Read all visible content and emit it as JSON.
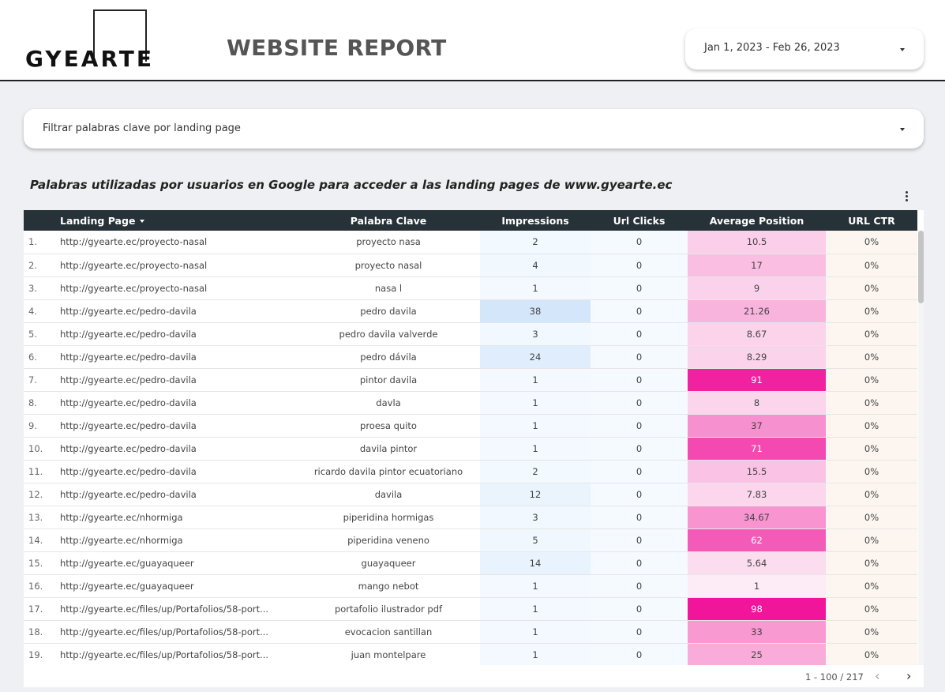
{
  "header": {
    "logo_text": "GYEARTE",
    "title": "WEBSITE REPORT",
    "date_range": "Jan 1, 2023 - Feb 26, 2023"
  },
  "filter": {
    "label": "Filtrar palabras clave por landing page"
  },
  "report": {
    "subtitle": "Palabras utilizadas por usuarios en Google para acceder a las landing pages de www.gyearte.ec"
  },
  "table": {
    "columns": [
      "Landing Page",
      "Palabra Clave",
      "Impressions",
      "Url Clicks",
      "Average Position",
      "URL CTR"
    ],
    "sorted_column": "Landing Page",
    "rows": [
      {
        "idx": "1.",
        "landing": "http://gyearte.ec/proyecto-nasal",
        "keyword": "proyecto nasa",
        "impressions": 2,
        "clicks": 0,
        "position": 10.5,
        "ctr": "0%"
      },
      {
        "idx": "2.",
        "landing": "http://gyearte.ec/proyecto-nasal",
        "keyword": "proyecto nasal",
        "impressions": 4,
        "clicks": 0,
        "position": 17,
        "ctr": "0%"
      },
      {
        "idx": "3.",
        "landing": "http://gyearte.ec/proyecto-nasal",
        "keyword": "nasa l",
        "impressions": 1,
        "clicks": 0,
        "position": 9,
        "ctr": "0%"
      },
      {
        "idx": "4.",
        "landing": "http://gyearte.ec/pedro-davila",
        "keyword": "pedro davila",
        "impressions": 38,
        "clicks": 0,
        "position": 21.26,
        "ctr": "0%"
      },
      {
        "idx": "5.",
        "landing": "http://gyearte.ec/pedro-davila",
        "keyword": "pedro davila valverde",
        "impressions": 3,
        "clicks": 0,
        "position": 8.67,
        "ctr": "0%"
      },
      {
        "idx": "6.",
        "landing": "http://gyearte.ec/pedro-davila",
        "keyword": "pedro dávila",
        "impressions": 24,
        "clicks": 0,
        "position": 8.29,
        "ctr": "0%"
      },
      {
        "idx": "7.",
        "landing": "http://gyearte.ec/pedro-davila",
        "keyword": "pintor davila",
        "impressions": 1,
        "clicks": 0,
        "position": 91,
        "ctr": "0%"
      },
      {
        "idx": "8.",
        "landing": "http://gyearte.ec/pedro-davila",
        "keyword": "davla",
        "impressions": 1,
        "clicks": 0,
        "position": 8,
        "ctr": "0%"
      },
      {
        "idx": "9.",
        "landing": "http://gyearte.ec/pedro-davila",
        "keyword": "proesa quito",
        "impressions": 1,
        "clicks": 0,
        "position": 37,
        "ctr": "0%"
      },
      {
        "idx": "10.",
        "landing": "http://gyearte.ec/pedro-davila",
        "keyword": "davila pintor",
        "impressions": 1,
        "clicks": 0,
        "position": 71,
        "ctr": "0%"
      },
      {
        "idx": "11.",
        "landing": "http://gyearte.ec/pedro-davila",
        "keyword": "ricardo davila pintor ecuatoriano",
        "impressions": 2,
        "clicks": 0,
        "position": 15.5,
        "ctr": "0%"
      },
      {
        "idx": "12.",
        "landing": "http://gyearte.ec/pedro-davila",
        "keyword": "davila",
        "impressions": 12,
        "clicks": 0,
        "position": 7.83,
        "ctr": "0%"
      },
      {
        "idx": "13.",
        "landing": "http://gyearte.ec/nhormiga",
        "keyword": "piperidina hormigas",
        "impressions": 3,
        "clicks": 0,
        "position": 34.67,
        "ctr": "0%"
      },
      {
        "idx": "14.",
        "landing": "http://gyearte.ec/nhormiga",
        "keyword": "piperidina veneno",
        "impressions": 5,
        "clicks": 0,
        "position": 62,
        "ctr": "0%"
      },
      {
        "idx": "15.",
        "landing": "http://gyearte.ec/guayaqueer",
        "keyword": "guayaqueer",
        "impressions": 14,
        "clicks": 0,
        "position": 5.64,
        "ctr": "0%"
      },
      {
        "idx": "16.",
        "landing": "http://gyearte.ec/guayaqueer",
        "keyword": "mango nebot",
        "impressions": 1,
        "clicks": 0,
        "position": 1,
        "ctr": "0%"
      },
      {
        "idx": "17.",
        "landing": "http://gyearte.ec/files/up/Portafolios/58-port...",
        "keyword": "portafolio ilustrador pdf",
        "impressions": 1,
        "clicks": 0,
        "position": 98,
        "ctr": "0%"
      },
      {
        "idx": "18.",
        "landing": "http://gyearte.ec/files/up/Portafolios/58-port...",
        "keyword": "evocacion santillan",
        "impressions": 1,
        "clicks": 0,
        "position": 33,
        "ctr": "0%"
      },
      {
        "idx": "19.",
        "landing": "http://gyearte.ec/files/up/Portafolios/58-port...",
        "keyword": "juan montelpare",
        "impressions": 1,
        "clicks": 0,
        "position": 25,
        "ctr": "0%"
      }
    ]
  },
  "pagination": {
    "range": "1 - 100 / 217",
    "prev_icon": "chevron-left-icon",
    "next_icon": "chevron-right-icon"
  },
  "colors": {
    "header_bg": "#263238",
    "impressions_heat": "#d4e6fa",
    "position_heat": "#f0159a",
    "page_bg": "#eef0f3"
  }
}
